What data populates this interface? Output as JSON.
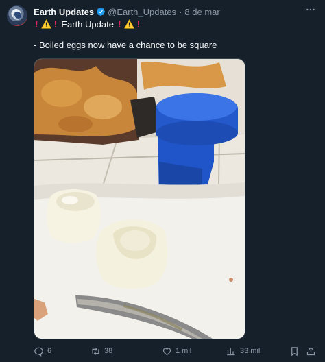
{
  "tweet": {
    "author_name": "Earth Updates",
    "author_handle": "@Earth_Updates",
    "date": "8 de mar",
    "separator": "·",
    "headline_title": "Earth Update",
    "body": "- Boiled eggs now have a chance to be square",
    "icons": {
      "avatar": "earth-avatar",
      "verified": "verified-badge-icon",
      "more": "more-options-icon",
      "warning": "warning-icon",
      "exclamation": "red-exclamation-icon"
    }
  },
  "actions": {
    "replies": "6",
    "reposts": "38",
    "likes": "1 mil",
    "views": "33 mil",
    "icons": [
      "reply-icon",
      "repost-icon",
      "like-icon",
      "views-icon",
      "bookmark-icon",
      "share-icon"
    ]
  },
  "colors": {
    "background": "#15202b",
    "text": "#f7f9f9",
    "secondary_text": "#8b98a5",
    "verified": "#1d9bf0",
    "red": "#e0245e",
    "cup_blue": "#1f55c8"
  }
}
